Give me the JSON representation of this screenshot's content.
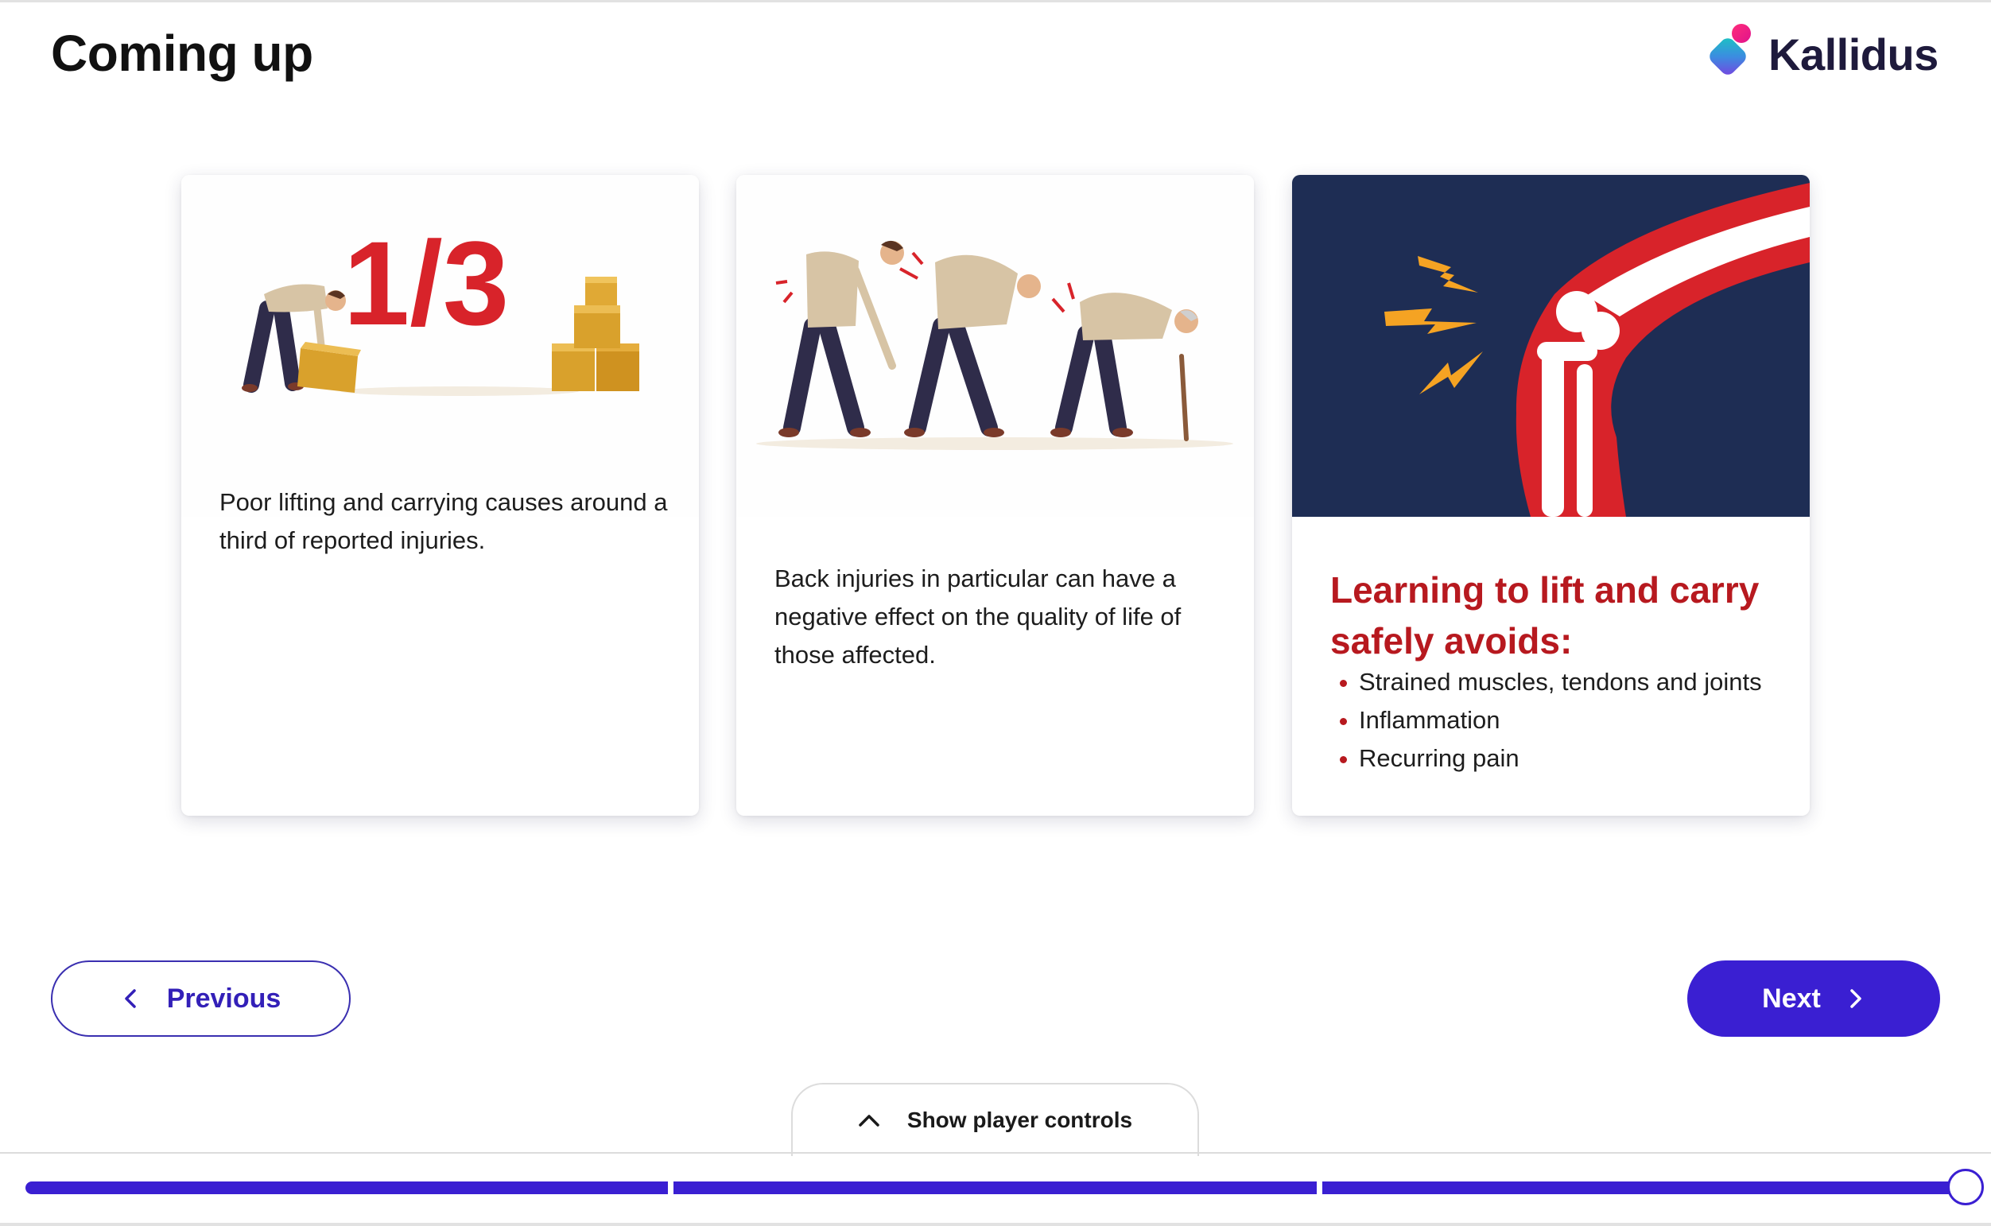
{
  "header": {
    "title": "Coming up",
    "logo_text": "Kallidus"
  },
  "cards": [
    {
      "image_icon": "lifting-boxes-illustration",
      "image_text": "1/3",
      "text": "Poor lifting and carrying causes around a third of reported injuries."
    },
    {
      "image_icon": "back-pain-illustration",
      "text": "Back injuries in particular can have a negative effect on the quality of life of those affected."
    },
    {
      "image_icon": "knee-joint-pain-illustration",
      "heading": "Learning to lift and carry safely avoids:",
      "bullets": [
        "Strained muscles, tendons and joints",
        "Inflammation",
        "Recurring pain"
      ]
    }
  ],
  "navigation": {
    "previous_label": "Previous",
    "next_label": "Next",
    "player_controls_label": "Show player controls"
  },
  "progress": {
    "segments": 3,
    "completed_fraction": 1.0
  },
  "colors": {
    "accent": "#3a1fd2",
    "heading_red": "#b7191f",
    "navy": "#1e2d54",
    "box_gold": "#d9a12c"
  }
}
